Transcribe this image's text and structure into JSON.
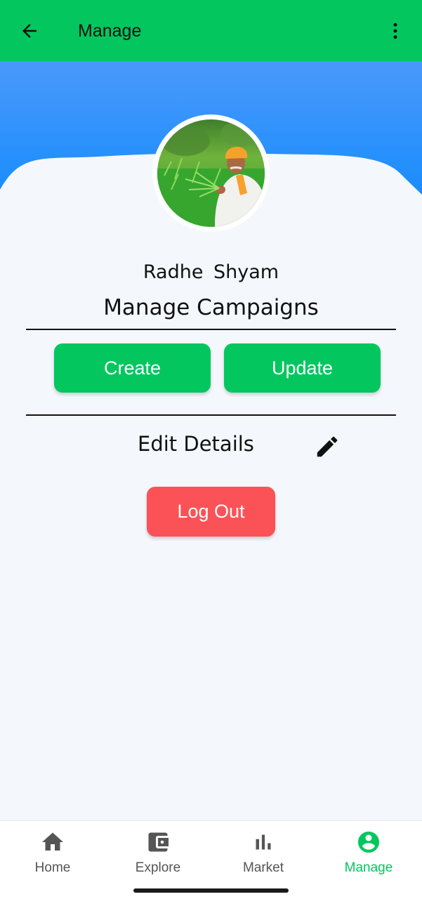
{
  "app_bar": {
    "title": "Manage",
    "back_icon": "arrow-left-icon",
    "menu_icon": "more-vert-icon",
    "color": "#03c75e"
  },
  "banner": {
    "color": "#198dfc"
  },
  "profile": {
    "name": "Radhe  Shyam",
    "avatar_icon": "profile-photo-farmer"
  },
  "campaigns": {
    "title": "Manage Campaigns",
    "create_label": "Create",
    "update_label": "Update",
    "button_color": "#03c75e"
  },
  "details": {
    "edit_label": "Edit Details",
    "edit_icon": "pencil-icon"
  },
  "logout": {
    "label": "Log Out",
    "color": "#fb5257"
  },
  "bottom_nav": {
    "active_color": "#03c75e",
    "items": [
      {
        "label": "Home",
        "icon": "home-icon",
        "active": false
      },
      {
        "label": "Explore",
        "icon": "wallet-icon",
        "active": false
      },
      {
        "label": "Market",
        "icon": "bar-chart-icon",
        "active": false
      },
      {
        "label": "Manage",
        "icon": "account-circle-icon",
        "active": true
      }
    ]
  }
}
